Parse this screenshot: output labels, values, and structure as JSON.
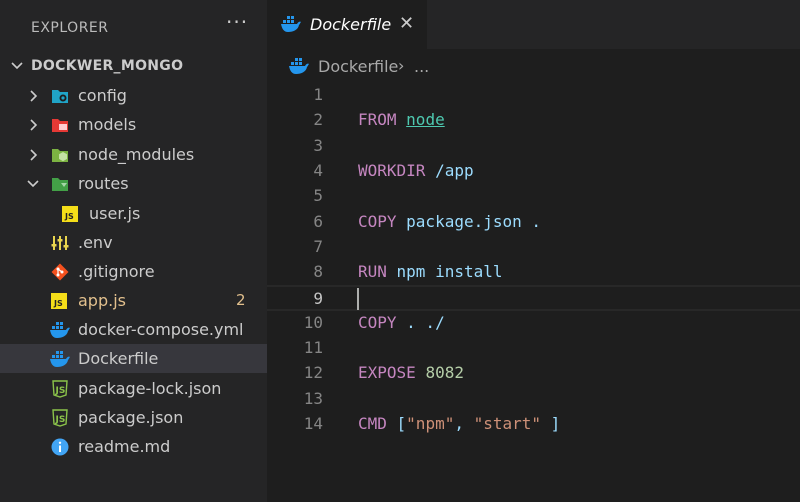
{
  "explorer": {
    "title": "EXPLORER",
    "more_label": "···"
  },
  "tree": {
    "root": "DOCKWER_MONGO",
    "items": [
      {
        "label": "config",
        "icon": "folder-config-icon"
      },
      {
        "label": "models",
        "icon": "folder-models-icon"
      },
      {
        "label": "node_modules",
        "icon": "folder-node-icon"
      },
      {
        "label": "routes",
        "icon": "folder-routes-icon"
      },
      {
        "label": "user.js",
        "icon": "js-file-icon"
      },
      {
        "label": ".env",
        "icon": "env-file-icon"
      },
      {
        "label": ".gitignore",
        "icon": "git-file-icon"
      },
      {
        "label": "app.js",
        "icon": "js-file-icon",
        "badge": "2"
      },
      {
        "label": "docker-compose.yml",
        "icon": "docker-file-icon"
      },
      {
        "label": "Dockerfile",
        "icon": "docker-file-icon"
      },
      {
        "label": "package-lock.json",
        "icon": "json-file-icon"
      },
      {
        "label": "package.json",
        "icon": "json-file-icon"
      },
      {
        "label": "readme.md",
        "icon": "info-file-icon"
      }
    ]
  },
  "tab": {
    "label": "Dockerfile",
    "close": "✕"
  },
  "breadcrumb": {
    "file": "Dockerfile",
    "separator": "›",
    "ellipsis": "..."
  },
  "editor": {
    "current_line": 9,
    "lines": [
      {
        "n": "1",
        "tokens": []
      },
      {
        "n": "2",
        "tokens": [
          {
            "t": "FROM",
            "c": "kw"
          },
          {
            "t": " ",
            "c": ""
          },
          {
            "t": "node",
            "c": "link"
          }
        ]
      },
      {
        "n": "3",
        "tokens": []
      },
      {
        "n": "4",
        "tokens": [
          {
            "t": "WORKDIR",
            "c": "kw"
          },
          {
            "t": " /app",
            "c": "arg"
          }
        ]
      },
      {
        "n": "5",
        "tokens": []
      },
      {
        "n": "6",
        "tokens": [
          {
            "t": "COPY",
            "c": "kw"
          },
          {
            "t": " package.json .",
            "c": "arg"
          }
        ]
      },
      {
        "n": "7",
        "tokens": []
      },
      {
        "n": "8",
        "tokens": [
          {
            "t": "RUN",
            "c": "kw"
          },
          {
            "t": " npm install",
            "c": "arg"
          }
        ]
      },
      {
        "n": "9",
        "tokens": []
      },
      {
        "n": "10",
        "tokens": [
          {
            "t": "COPY",
            "c": "kw"
          },
          {
            "t": " . ./",
            "c": "arg"
          }
        ]
      },
      {
        "n": "11",
        "tokens": []
      },
      {
        "n": "12",
        "tokens": [
          {
            "t": "EXPOSE",
            "c": "kw"
          },
          {
            "t": " ",
            "c": ""
          },
          {
            "t": "8082",
            "c": "num"
          }
        ]
      },
      {
        "n": "13",
        "tokens": []
      },
      {
        "n": "14",
        "tokens": [
          {
            "t": "CMD",
            "c": "kw"
          },
          {
            "t": " [",
            "c": "arg"
          },
          {
            "t": "\"npm\"",
            "c": "str"
          },
          {
            "t": ", ",
            "c": "arg"
          },
          {
            "t": "\"start\"",
            "c": "str"
          },
          {
            "t": " ]",
            "c": "arg"
          }
        ]
      }
    ]
  },
  "colors": {
    "sidebar_bg": "#252526",
    "editor_bg": "#1e1e1e",
    "keyword": "#c586c0",
    "argument": "#9cdcfe",
    "string": "#ce9178",
    "number": "#b5cea8",
    "modified": "#e2c08d",
    "docker_blue": "#2496ed"
  }
}
